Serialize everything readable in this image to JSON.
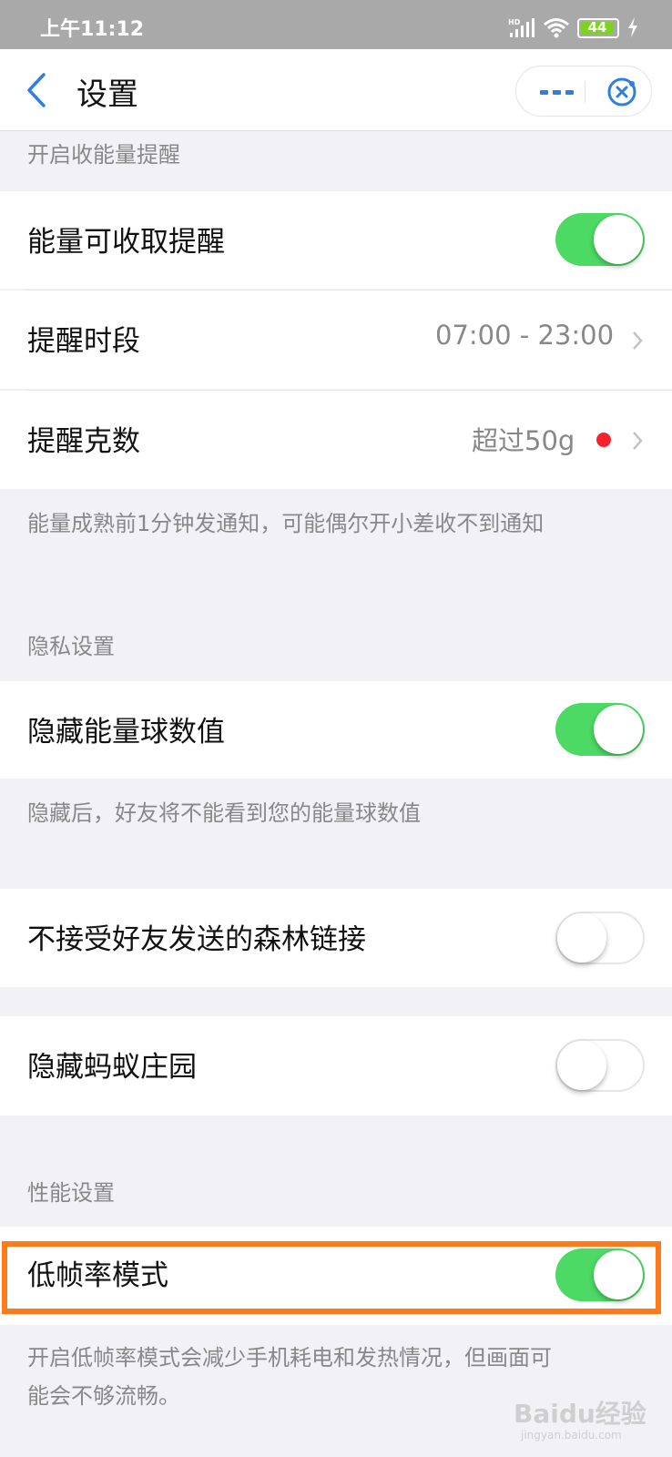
{
  "status_bar": {
    "time": "上午11:12",
    "network": "HD",
    "battery": "44",
    "icons": [
      "signal-icon",
      "wifi-icon",
      "battery-icon",
      "charging-icon"
    ]
  },
  "nav": {
    "title": "设置",
    "back_icon": "chevron-left-icon",
    "more_icon": "more-icon",
    "close_icon": "close-target-icon"
  },
  "energy_section": {
    "header": "开启收能量提醒",
    "rows": [
      {
        "label": "能量可收取提醒",
        "control": "toggle",
        "on": true
      },
      {
        "label": "提醒时段",
        "value": "07:00 - 23:00"
      },
      {
        "label": "提醒克数",
        "value": "超过50g",
        "badge": "red-dot"
      }
    ],
    "note": "能量成熟前1分钟发通知，可能偶尔开小差收不到通知"
  },
  "privacy_section": {
    "header": "隐私设置",
    "rows": [
      {
        "label": "隐藏能量球数值",
        "control": "toggle",
        "on": true
      }
    ],
    "note": "隐藏后，好友将不能看到您的能量球数值"
  },
  "standalone_rows": [
    {
      "label": "不接受好友发送的森林链接",
      "control": "toggle",
      "on": false
    },
    {
      "label": "隐藏蚂蚁庄园",
      "control": "toggle",
      "on": false
    }
  ],
  "performance_section": {
    "header": "性能设置",
    "rows": [
      {
        "label": "低帧率模式",
        "control": "toggle",
        "on": true
      }
    ],
    "note_line1": "开启低帧率模式会减少手机耗电和发热情况，但画面可",
    "note_line2": "能会不够流畅。"
  },
  "colors": {
    "accent_blue": "#2f7fe0",
    "toggle_on": "#4cd964",
    "highlight": "#ff7a1a",
    "badge_red": "#f5222d"
  },
  "watermark": {
    "text": "Baidu经验",
    "sub": "jingyan.baidu.com"
  }
}
